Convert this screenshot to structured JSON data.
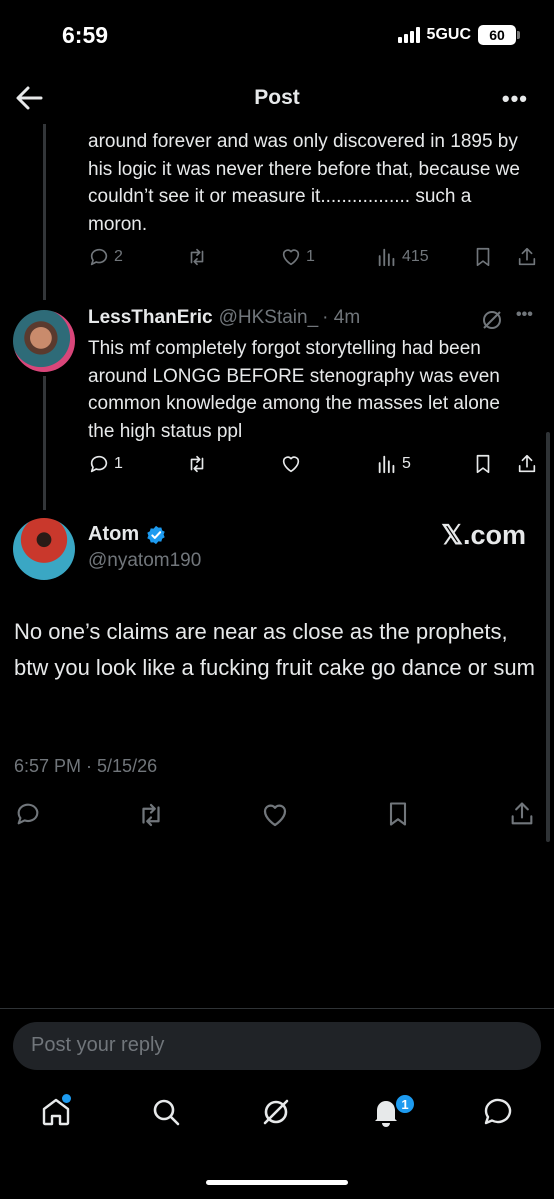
{
  "status_bar": {
    "time": "6:59",
    "network": "5GUC",
    "battery": "60"
  },
  "header": {
    "title": "Post"
  },
  "previous_reply": {
    "text": "around forever and was only discovered in 1895 by his logic it was never there before that,  because we couldn’t see it or measure it................. such a moron.",
    "replies": "2",
    "reposts": "",
    "likes": "1",
    "views": "415"
  },
  "reply": {
    "display_name": "LessThanEric",
    "handle": "@HKStain_",
    "time": "· 4m",
    "text": "This mf completely forgot storytelling had been around LONGG BEFORE stenography was even common knowledge among the masses let alone the high status ppl",
    "replies": "1",
    "views": "5"
  },
  "main_post": {
    "display_name": "Atom",
    "handle": "@nyatom190",
    "watermark": "𝕏.com",
    "text": "No one’s claims are near as close as the prophets, btw you look like a fucking fruit cake go dance or sum",
    "timestamp": "6:57 PM · 5/15/26"
  },
  "reply_bar": {
    "placeholder": "Post your reply"
  },
  "tabbar": {
    "notifications_badge": "1"
  },
  "colors": {
    "background": "#000000",
    "text": "#e7e9ea",
    "muted": "#71767b",
    "accent": "#1d9bf0"
  },
  "icons": [
    "back-arrow-icon",
    "more-icon",
    "reply-icon",
    "repost-icon",
    "like-icon",
    "views-icon",
    "bookmark-icon",
    "share-icon",
    "grok-icon",
    "verified-icon",
    "home-icon",
    "search-icon",
    "bell-icon",
    "messages-icon"
  ]
}
